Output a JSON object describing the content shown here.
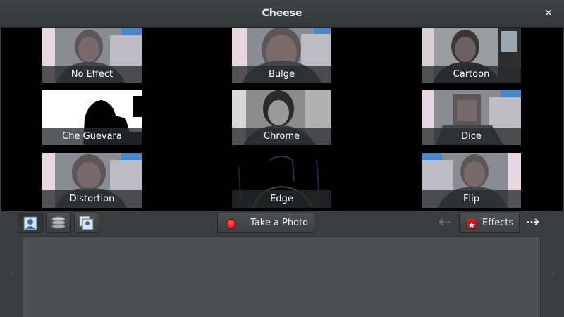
{
  "window": {
    "title": "Cheese",
    "close_label": "✕"
  },
  "effects": [
    {
      "label": "No Effect"
    },
    {
      "label": "Bulge"
    },
    {
      "label": "Cartoon"
    },
    {
      "label": "Che Guevara"
    },
    {
      "label": "Chrome"
    },
    {
      "label": "Dice"
    },
    {
      "label": "Distortion"
    },
    {
      "label": "Edge"
    },
    {
      "label": "Flip"
    }
  ],
  "toolbar": {
    "take_photo_label": "Take a Photo",
    "effects_label": "Effects",
    "prev_arrow": "⇠",
    "next_arrow": "⇢",
    "mode_buttons": [
      {
        "icon": "photo-mode-icon",
        "active": true
      },
      {
        "icon": "burst-mode-icon",
        "active": false
      },
      {
        "icon": "video-mode-icon",
        "active": false
      }
    ]
  },
  "strip": {
    "left_arrow": "‹",
    "right_arrow": "›"
  }
}
